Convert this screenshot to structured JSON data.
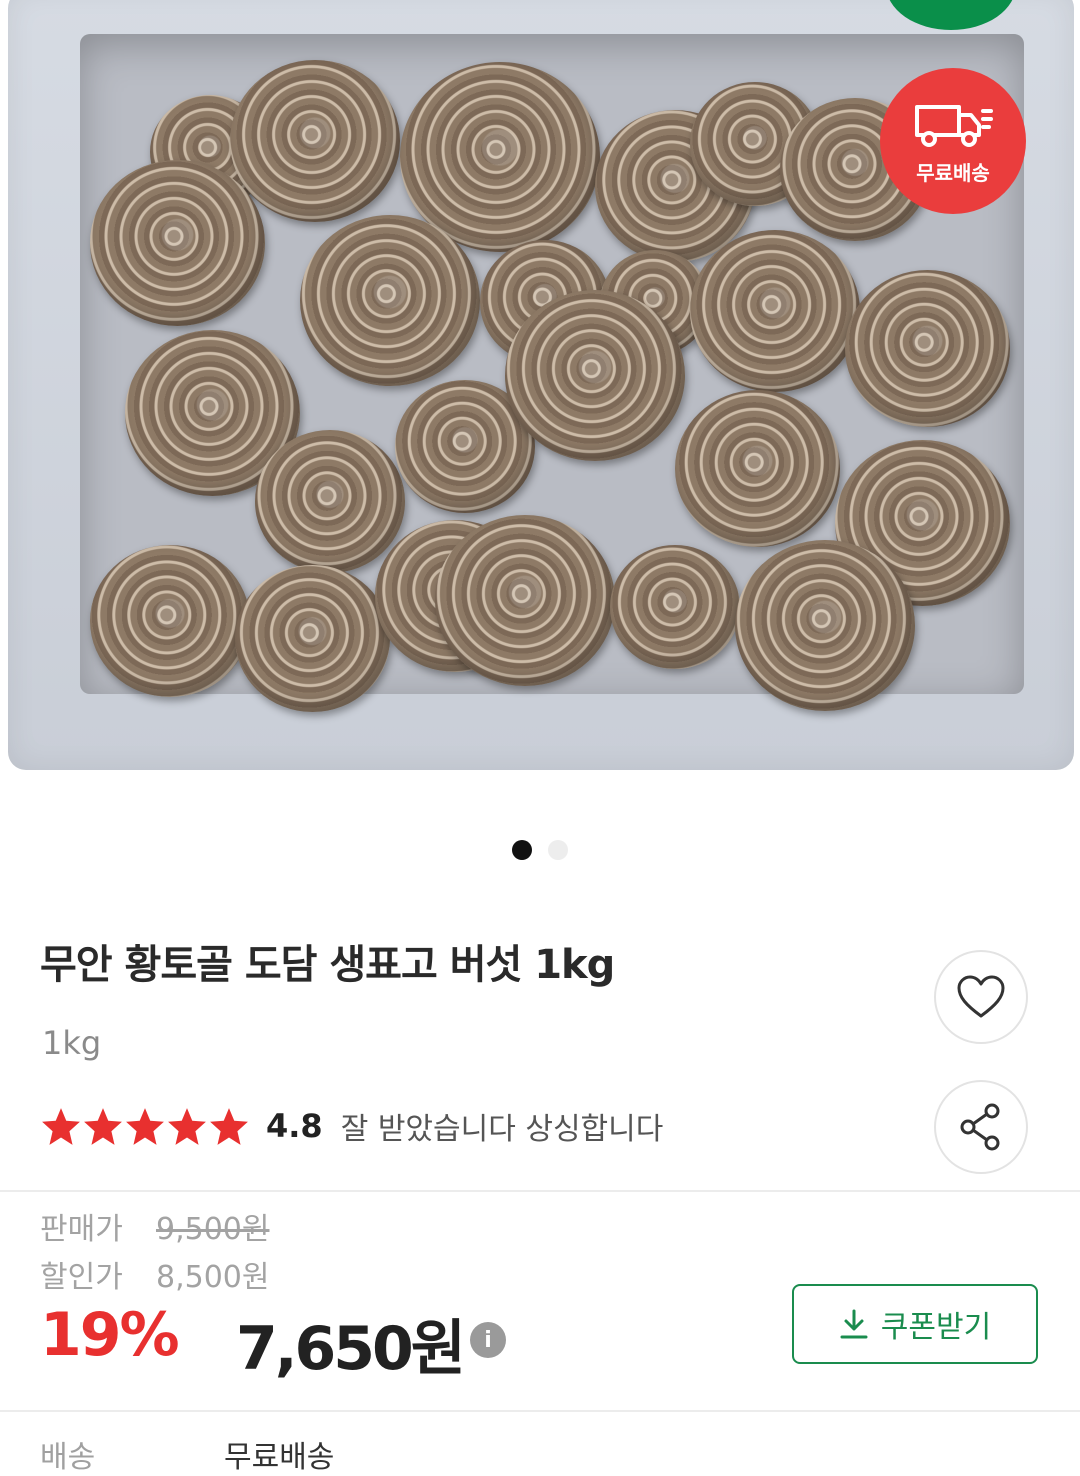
{
  "product": {
    "title": "무안 황토골 도담 생표고 버섯 1kg",
    "option": "1kg",
    "rating": "4.8",
    "stars": 5,
    "review_snippet": "잘 받았습니다 상싱합니다"
  },
  "badge": {
    "free_shipping_label": "무료배송"
  },
  "gallery": {
    "page_count": 2,
    "current_page": 1
  },
  "price": {
    "sale_label": "판매가",
    "sale_price": "9,500원",
    "discount_label": "할인가",
    "discount_price": "8,500원",
    "discount_rate": "19%",
    "final_price": "7,650원"
  },
  "coupon": {
    "label": "쿠폰받기"
  },
  "shipping": {
    "label": "배송",
    "value": "무료배송"
  },
  "colors": {
    "accent_red": "#e8302f",
    "accent_green": "#1a8c4e",
    "badge_red": "#ea3d3d"
  },
  "icons": [
    "heart-icon",
    "share-icon",
    "truck-icon",
    "info-icon",
    "download-icon",
    "star-icon"
  ]
}
